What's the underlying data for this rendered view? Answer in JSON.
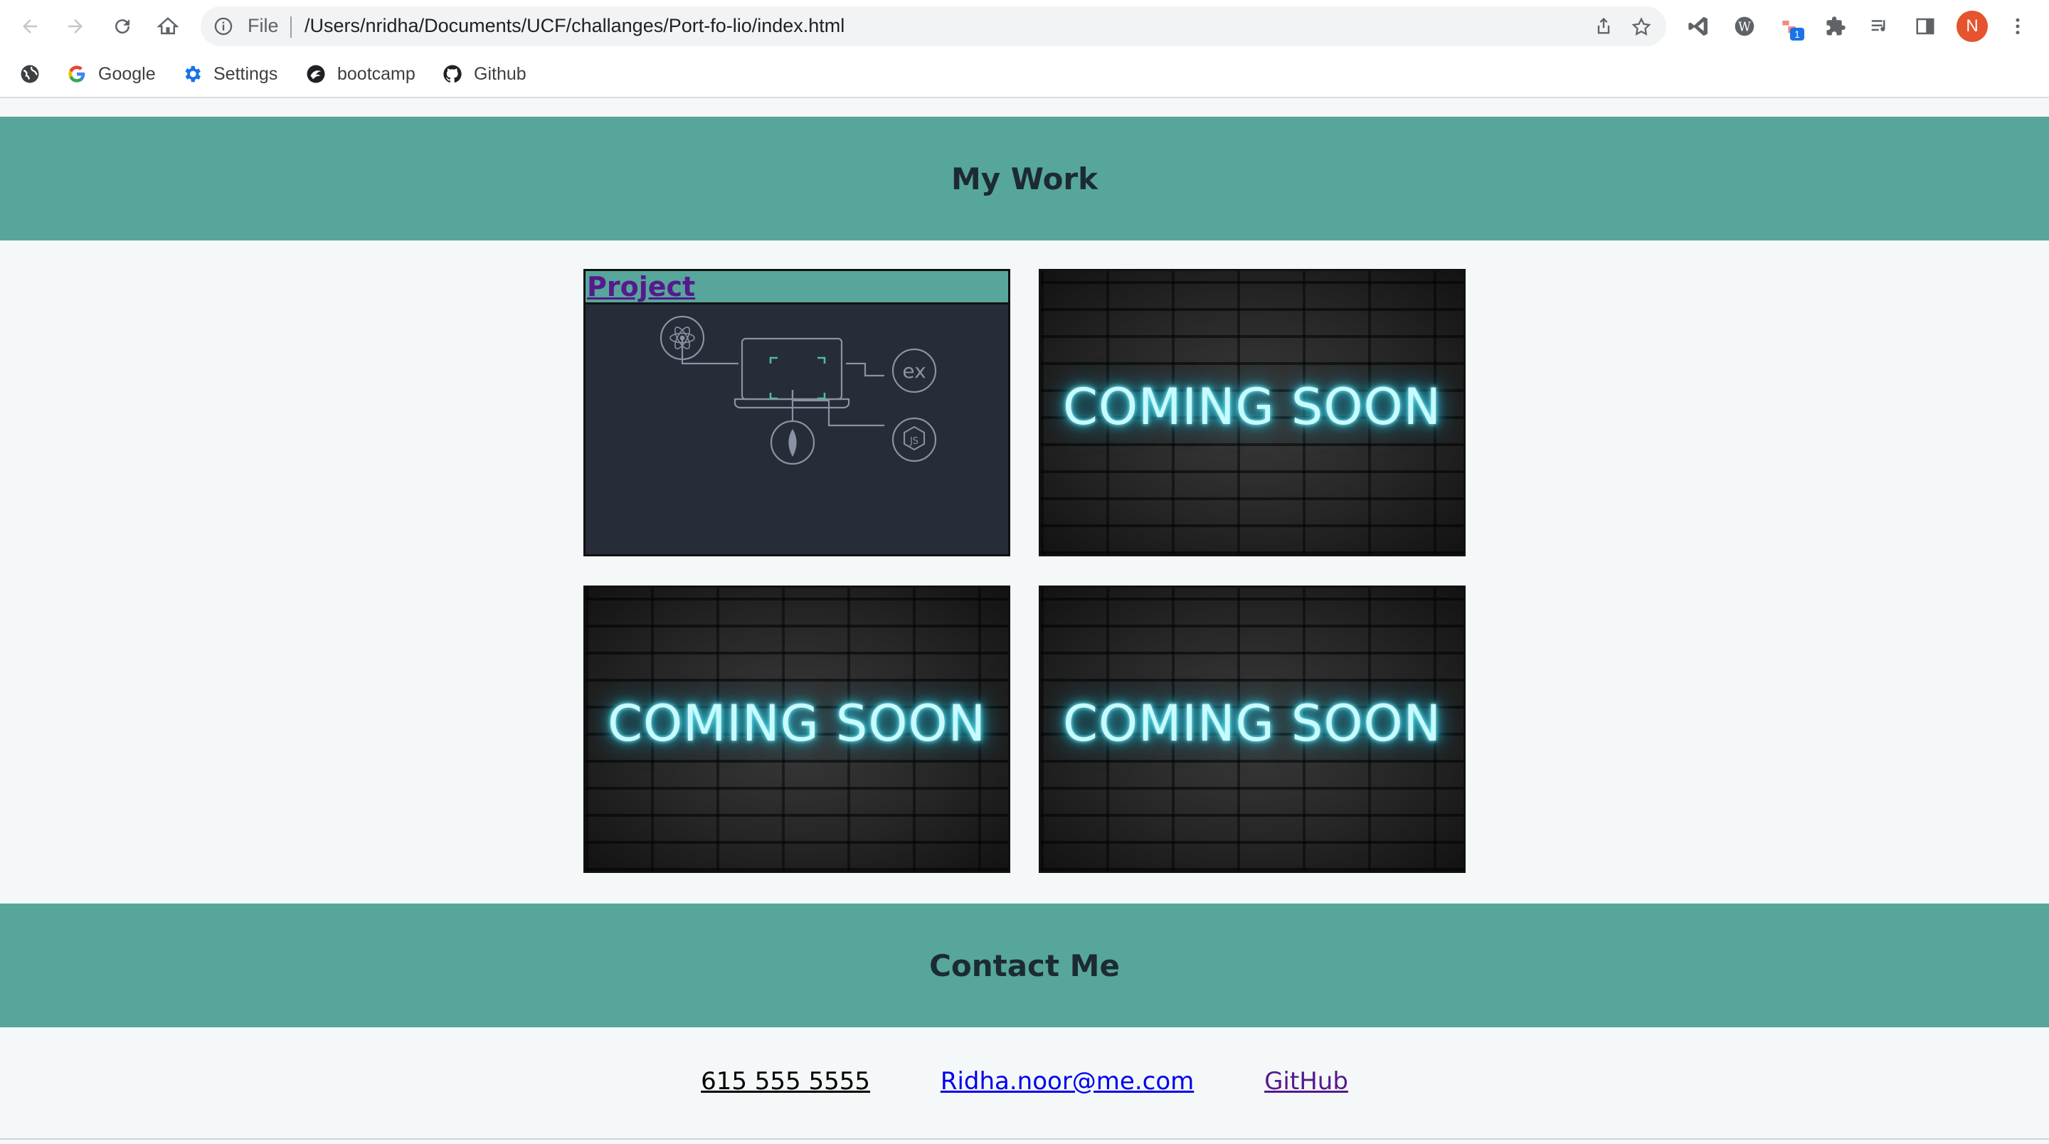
{
  "browser": {
    "omnibox": {
      "scheme_label": "File",
      "url": "/Users/nridha/Documents/UCF/challanges/Port-fo-lio/index.html"
    },
    "extension_badge": "1",
    "profile_initial": "N",
    "bookmarks": [
      {
        "label": "Google",
        "icon": "google-icon"
      },
      {
        "label": "Settings",
        "icon": "gear-icon"
      },
      {
        "label": "bootcamp",
        "icon": "bootcamp-icon"
      },
      {
        "label": "Github",
        "icon": "github-icon"
      }
    ]
  },
  "page": {
    "work_heading": "My Work",
    "projects": [
      {
        "title": "Project",
        "image": "mern-stack-diagram",
        "image_labels": [
          "ex",
          "JS"
        ]
      },
      {
        "image_text": "COMING SOON"
      },
      {
        "image_text": "COMING SOON"
      },
      {
        "image_text": "COMING SOON"
      }
    ],
    "contact_heading": "Contact Me",
    "contact": {
      "phone": "615 555 5555",
      "email": "Ridha.noor@me.com",
      "github": "GitHub"
    }
  },
  "colors": {
    "accent": "#57a69c",
    "page_bg": "#f4f8f8",
    "heading_text": "#1c2b33",
    "visited_link": "#551a8b",
    "link": "#0000ee",
    "neon": "#7ff3ff"
  }
}
